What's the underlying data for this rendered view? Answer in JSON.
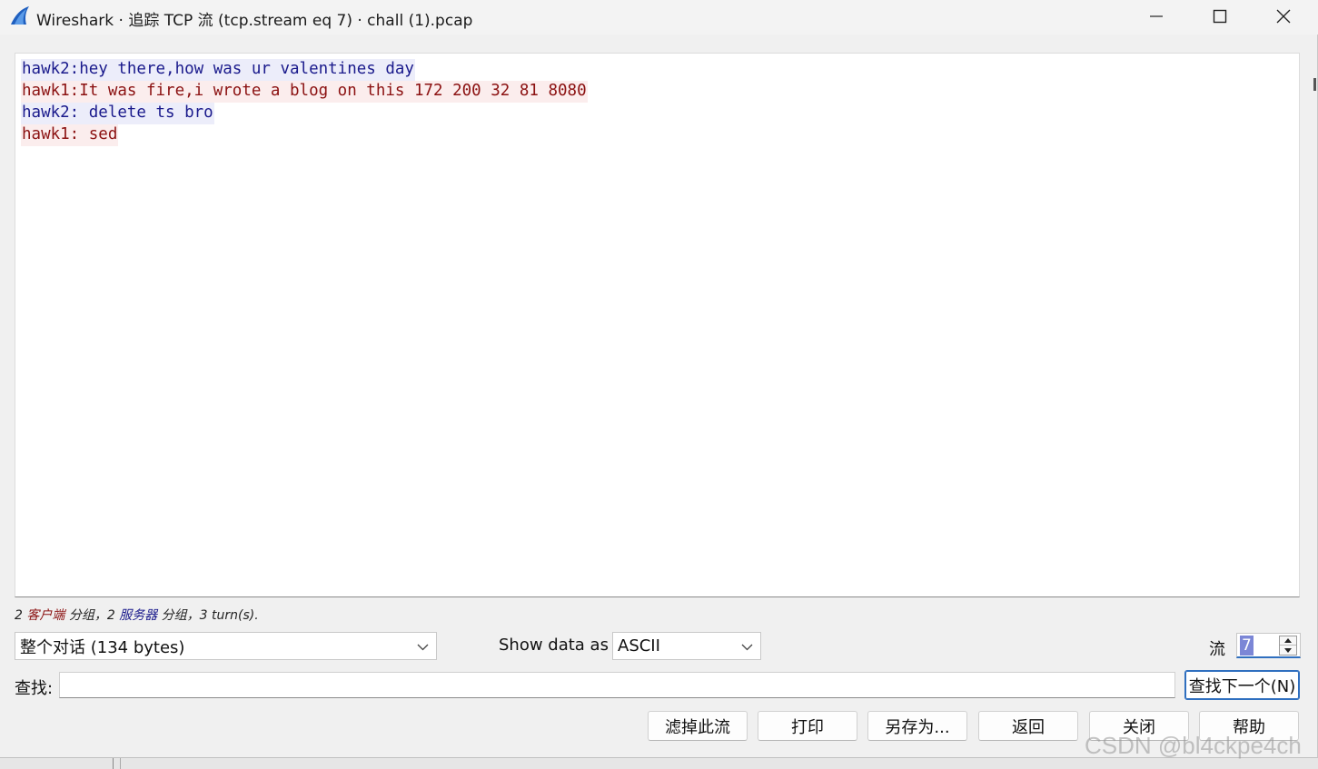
{
  "window": {
    "title": "Wireshark · 追踪 TCP 流 (tcp.stream eq 7) · chall (1).pcap",
    "icon": "wireshark-fin-icon"
  },
  "stream": {
    "lines": [
      {
        "side": "client",
        "text": "hawk2:hey there,how was ur valentines day"
      },
      {
        "side": "server",
        "text": "hawk1:It was fire,i wrote a blog on this 172 200 32 81 8080"
      },
      {
        "side": "client",
        "text": "hawk2: delete ts bro"
      },
      {
        "side": "server",
        "text": "hawk1: sed"
      }
    ],
    "colors": {
      "client_text": "#1a1a8c",
      "client_bg": "#ecedfa",
      "server_text": "#8b1111",
      "server_bg": "#fbeded"
    }
  },
  "stats": {
    "client_count": "2",
    "client_word": "客户端",
    "client_suffix": "分组，",
    "server_count": "2",
    "server_word": "服务器",
    "server_suffix": "分组，",
    "turns": "3 turn(s)."
  },
  "controls": {
    "conversation_select": "整个对话 (134 bytes)",
    "show_data_label": "Show data as",
    "format_select": "ASCII",
    "stream_label": "流",
    "stream_value": "7"
  },
  "find": {
    "label": "查找:",
    "value": "",
    "next_button": "查找下一个(N)"
  },
  "buttons": {
    "filter_out": "滤掉此流",
    "print": "打印",
    "save_as": "另存为...",
    "back": "返回",
    "close": "关闭",
    "help": "帮助"
  },
  "watermark": "CSDN @bl4ckpe4ch"
}
